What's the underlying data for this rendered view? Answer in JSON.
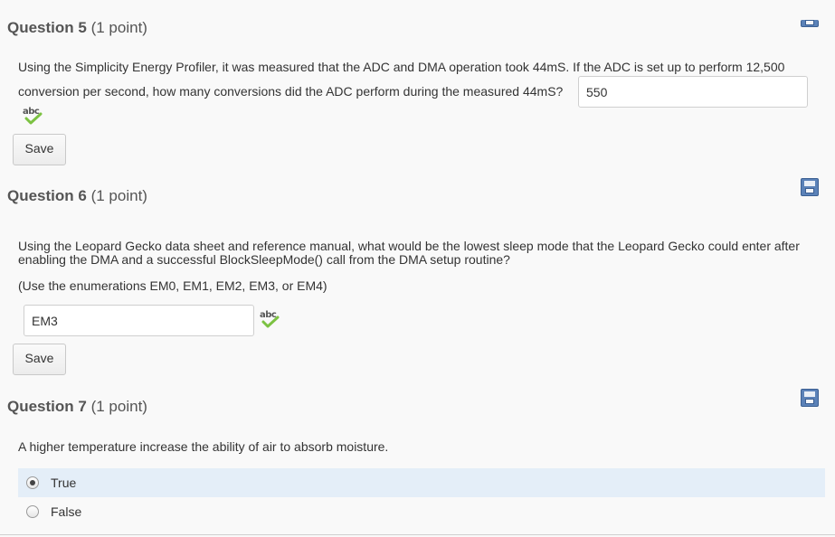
{
  "icons": {
    "save": "floppy-disk-icon",
    "spellcheck": "spellcheck-abc-icon"
  },
  "colors": {
    "selected_row": "#e4eef8",
    "save_icon": "#5b82b8",
    "check": "#7cc242"
  },
  "q5": {
    "title_num": "Question 5",
    "title_points": "(1 point)",
    "text_line1": "Using the Simplicity Energy Profiler, it was measured that the ADC and DMA operation took 44mS.  If the ADC is set up to perform 12,500",
    "text_line2": "conversion per second, how many conversions did the ADC perform during the measured 44mS?",
    "answer": "550",
    "save_label": "Save"
  },
  "q6": {
    "title_num": "Question 6",
    "title_points": "(1 point)",
    "text_line1": "Using the Leopard Gecko data sheet and reference manual, what would be the lowest sleep mode that the Leopard Gecko could enter after",
    "text_line2": "enabling the DMA and a successful BlockSleepMode() call from the DMA setup routine?",
    "text_note": "(Use the enumerations EM0, EM1, EM2, EM3, or EM4)",
    "answer": "EM3",
    "save_label": "Save"
  },
  "q7": {
    "title_num": "Question 7",
    "title_points": "(1 point)",
    "text": "A higher temperature increase the ability of air to absorb moisture.",
    "options": [
      {
        "label": "True",
        "selected": true
      },
      {
        "label": "False",
        "selected": false
      }
    ]
  }
}
